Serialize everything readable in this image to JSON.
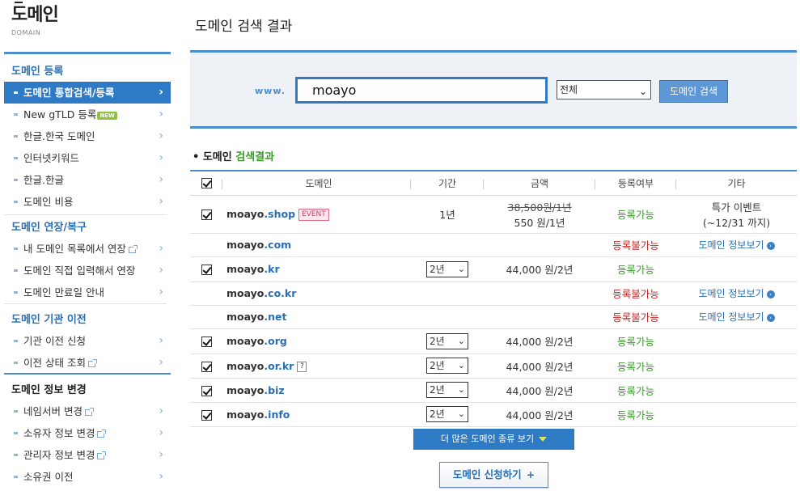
{
  "logo": {
    "title": "도메인",
    "sub": "DOMAIN"
  },
  "sidebar": {
    "sections": [
      {
        "title": "도메인 등록",
        "items": [
          {
            "label": "도메인 통합검색/등록",
            "active": true
          },
          {
            "label": "New gTLD 등록",
            "badge": "NEW"
          },
          {
            "label": "한글.한국 도메인"
          },
          {
            "label": "인터넷키워드"
          },
          {
            "label": "한글.한글"
          },
          {
            "label": "도메인 비용"
          }
        ]
      },
      {
        "title": "도메인 연장/복구",
        "items": [
          {
            "label": "내 도메인 목록에서 연장",
            "ext": true
          },
          {
            "label": "도메인 직접 입력해서 연장"
          },
          {
            "label": "도메인 만료일 안내"
          }
        ]
      },
      {
        "title": "도메인 기관 이전",
        "items": [
          {
            "label": "기관 이전 신청"
          },
          {
            "label": "이전 상태 조회",
            "ext": true
          }
        ]
      },
      {
        "title": "도메인 정보 변경",
        "items": [
          {
            "label": "네임서버 변경",
            "ext": true
          },
          {
            "label": "소유자 정보 변경",
            "ext": true
          },
          {
            "label": "관리자 정보 변경",
            "ext": true
          },
          {
            "label": "소유권 이전"
          }
        ]
      }
    ]
  },
  "main": {
    "title": "도메인 검색 결과",
    "search": {
      "prefix": "www.",
      "value": "moayo",
      "select": "전체",
      "button": "도메인 검색"
    },
    "result_heading": {
      "bullet": "•",
      "prefix": "도메인",
      "highlight": "검색결과"
    },
    "columns": [
      "도메인",
      "기간",
      "금액",
      "등록여부",
      "기타"
    ],
    "rows": [
      {
        "checked": true,
        "name": "moayo",
        "tld": ".shop",
        "badge": "EVENT",
        "period": "1년",
        "price_old": "38,500원/1년",
        "price": "550 원/1년",
        "status": "등록가능",
        "status_ok": true,
        "etc1": "특가 이벤트",
        "etc2": "(~12/31 까지)"
      },
      {
        "checked": null,
        "name": "moayo",
        "tld": ".com",
        "status": "등록불가능",
        "status_ok": false,
        "link": "도메인 정보보기"
      },
      {
        "checked": true,
        "name": "moayo",
        "tld": ".kr",
        "period_select": "2년",
        "price": "44,000 원/2년",
        "status": "등록가능",
        "status_ok": true
      },
      {
        "checked": null,
        "name": "moayo",
        "tld": ".co.kr",
        "status": "등록불가능",
        "status_ok": false,
        "link": "도메인 정보보기"
      },
      {
        "checked": null,
        "name": "moayo",
        "tld": ".net",
        "status": "등록불가능",
        "status_ok": false,
        "link": "도메인 정보보기"
      },
      {
        "checked": true,
        "name": "moayo",
        "tld": ".org",
        "period_select": "2년",
        "price": "44,000 원/2년",
        "status": "등록가능",
        "status_ok": true
      },
      {
        "checked": true,
        "name": "moayo",
        "tld": ".or.kr",
        "q": "?",
        "period_select": "2년",
        "price": "44,000 원/2년",
        "status": "등록가능",
        "status_ok": true
      },
      {
        "checked": true,
        "name": "moayo",
        "tld": ".biz",
        "period_select": "2년",
        "price": "44,000 원/2년",
        "status": "등록가능",
        "status_ok": true
      },
      {
        "checked": true,
        "name": "moayo",
        "tld": ".info",
        "period_select": "2년",
        "price": "44,000 원/2년",
        "status": "등록가능",
        "status_ok": true
      }
    ],
    "more_button": "더 많은 도메인 종류 보기",
    "apply_button": "도메인 신청하기",
    "apply_plus": "+"
  },
  "colors": {
    "accent": "#2f7ac4",
    "ok": "#3a9b2a",
    "no": "#c62828"
  }
}
